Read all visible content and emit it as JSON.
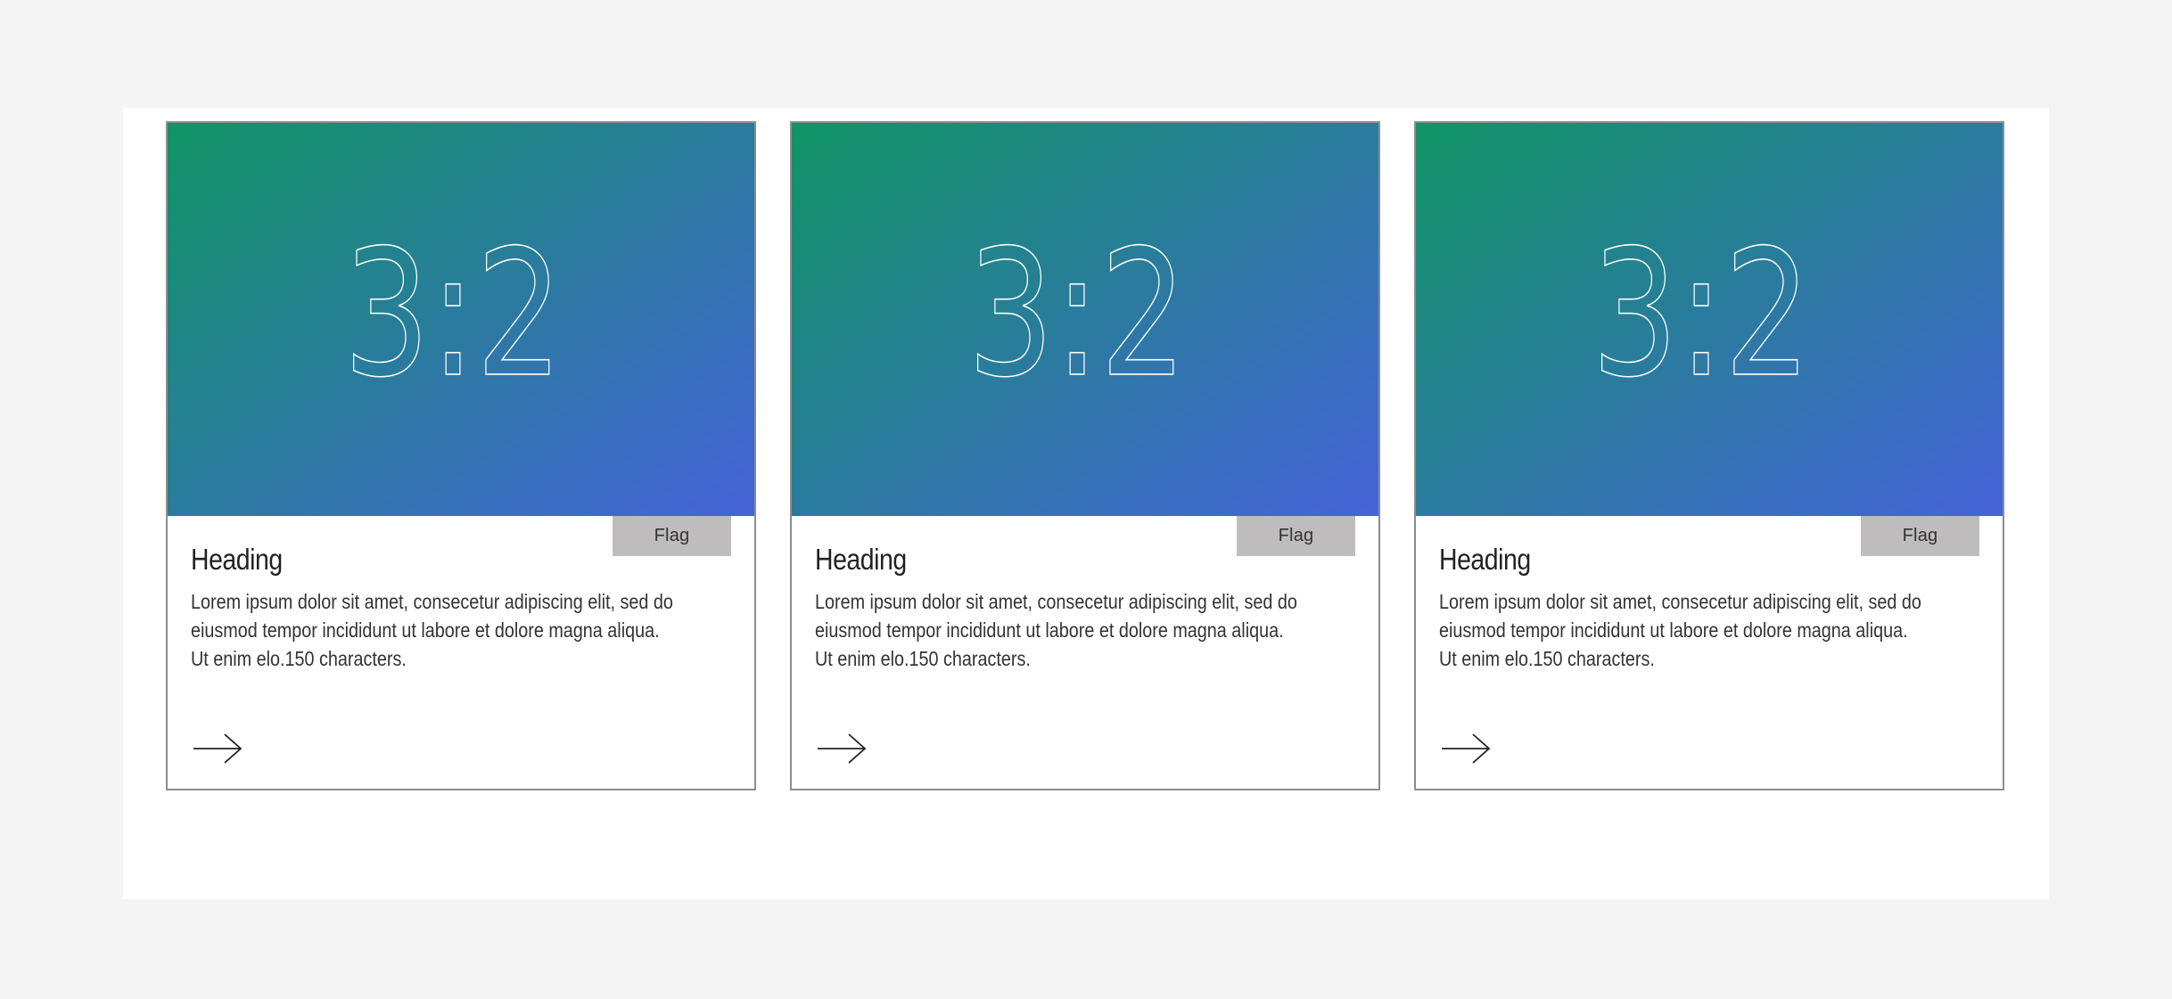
{
  "cards": [
    {
      "ratio_label": "3:2",
      "flag": "Flag",
      "heading": "Heading",
      "body": "Lorem ipsum dolor sit amet, consecetur adipiscing elit, sed do eiusmod tempor incididunt ut labore et dolore magna aliqua. Ut enim elo.150 characters.",
      "action_icon": "arrow-right-icon"
    },
    {
      "ratio_label": "3:2",
      "flag": "Flag",
      "heading": "Heading",
      "body": "Lorem ipsum dolor sit amet, consecetur adipiscing elit, sed do eiusmod tempor incididunt ut labore et dolore magna aliqua. Ut enim elo.150 characters.",
      "action_icon": "arrow-right-icon"
    },
    {
      "ratio_label": "3:2",
      "flag": "Flag",
      "heading": "Heading",
      "body": "Lorem ipsum dolor sit amet, consecetur adipiscing elit, sed do eiusmod tempor incididunt ut labore et dolore magna aliqua. Ut enim elo.150 characters.",
      "action_icon": "arrow-right-icon"
    }
  ],
  "colors": {
    "page_background": "#f4f4f4",
    "panel_background": "#ffffff",
    "gradient_start": "#0f9463",
    "gradient_end": "#4563d9",
    "flag_background": "#bebcbc",
    "card_border": "#8d8d8d"
  }
}
